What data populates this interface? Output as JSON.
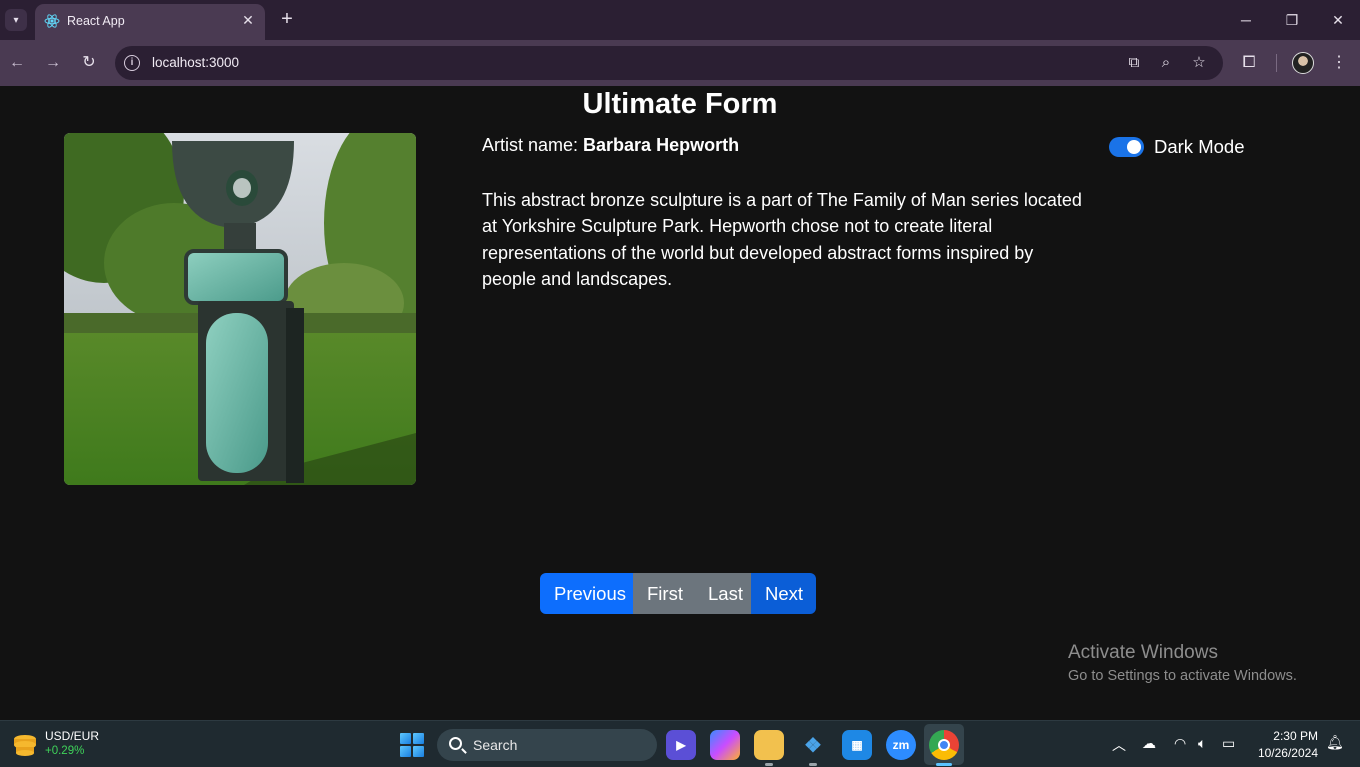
{
  "browser": {
    "tab_title": "React App",
    "url": "localhost:3000"
  },
  "page": {
    "title": "Ultimate Form",
    "artist_label": "Artist name: ",
    "artist_name": "Barbara Hepworth",
    "dark_mode_label": "Dark Mode",
    "dark_mode_on": true,
    "description": "This abstract bronze sculpture is a part of The Family of Man series located at Yorkshire Sculpture Park. Hepworth chose not to create literal representations of the world but developed abstract forms inspired by people and landscapes.",
    "pagination": {
      "previous": "Previous",
      "first": "First",
      "last": "Last",
      "next": "Next"
    },
    "watermark": {
      "line1": "Activate Windows",
      "line2": "Go to Settings to activate Windows."
    }
  },
  "taskbar": {
    "widget_title": "USD/EUR",
    "widget_value": "+0.29%",
    "search_label": "Search",
    "time": "2:30 PM",
    "date": "10/26/2024"
  },
  "colors": {
    "accent": "#0d6efd",
    "secondary": "#6c757d",
    "background": "#121212"
  }
}
